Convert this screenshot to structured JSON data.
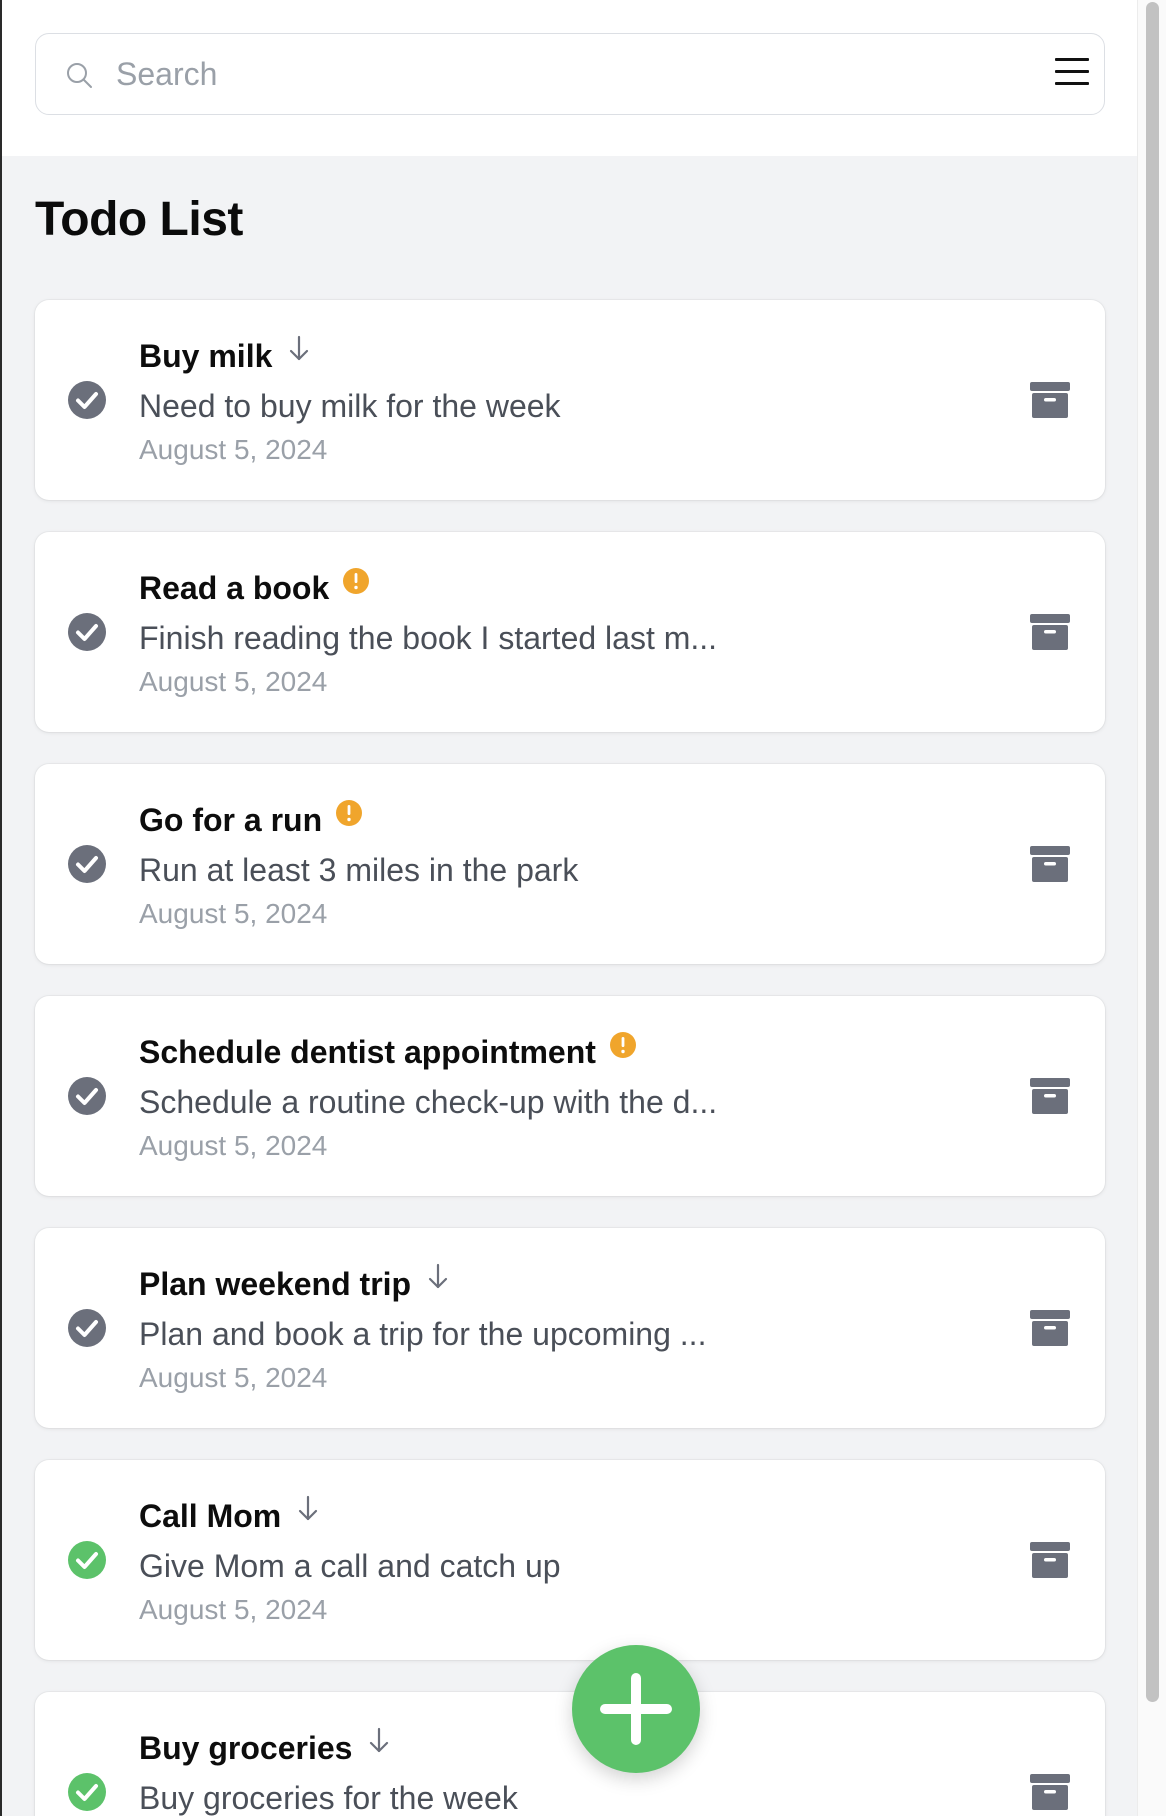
{
  "search": {
    "placeholder": "Search",
    "value": ""
  },
  "page": {
    "title": "Todo List"
  },
  "colors": {
    "check_done": "#5cc26a",
    "check_pending": "#6b6f7b",
    "priority": "#f0a52c",
    "archive": "#6b6f7b",
    "fab": "#5cc26a"
  },
  "todos": [
    {
      "title": "Buy milk",
      "description": "Need to buy milk for the week",
      "date": "August 5, 2024",
      "priority_icon": "arrow-down-icon",
      "completed": false
    },
    {
      "title": "Read a book",
      "description": "Finish reading the book I started last m...",
      "date": "August 5, 2024",
      "priority_icon": "exclamation-circle-icon",
      "completed": false
    },
    {
      "title": "Go for a run",
      "description": "Run at least 3 miles in the park",
      "date": "August 5, 2024",
      "priority_icon": "exclamation-circle-icon",
      "completed": false
    },
    {
      "title": "Schedule dentist appointment",
      "description": "Schedule a routine check-up with the d...",
      "date": "August 5, 2024",
      "priority_icon": "exclamation-circle-icon",
      "completed": false
    },
    {
      "title": "Plan weekend trip",
      "description": "Plan and book a trip for the upcoming ...",
      "date": "August 5, 2024",
      "priority_icon": "arrow-down-icon",
      "completed": false
    },
    {
      "title": "Call Mom",
      "description": "Give Mom a call and catch up",
      "date": "August 5, 2024",
      "priority_icon": "arrow-down-icon",
      "completed": true
    },
    {
      "title": "Buy groceries",
      "description": "Buy groceries for the week",
      "date": "",
      "priority_icon": "arrow-down-icon",
      "completed": true
    }
  ],
  "icons": {
    "search": "search-icon",
    "menu": "hamburger-menu-icon",
    "check": "check-circle-icon",
    "archive": "archive-icon",
    "add": "plus-icon"
  }
}
